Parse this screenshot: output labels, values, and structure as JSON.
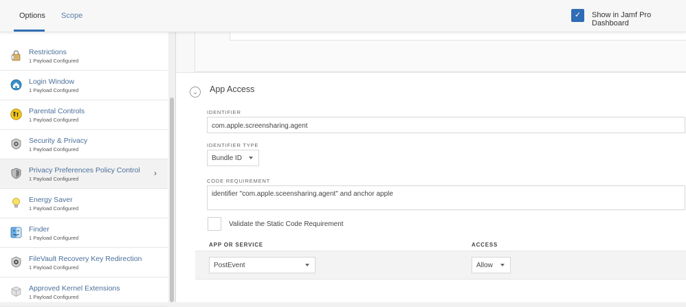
{
  "header": {
    "tabs": [
      {
        "label": "Options"
      },
      {
        "label": "Scope"
      }
    ],
    "dashboard_label": "Show in Jamf Pro Dashboard",
    "dashboard_checked": true,
    "accent_color": "#2f6db5"
  },
  "sidebar": {
    "items": [
      {
        "title": "Restrictions",
        "subtitle": "1 Payload Configured",
        "icon": "lock-icon"
      },
      {
        "title": "Login Window",
        "subtitle": "1 Payload Configured",
        "icon": "login-window-icon"
      },
      {
        "title": "Parental Controls",
        "subtitle": "1 Payload Configured",
        "icon": "parental-controls-icon"
      },
      {
        "title": "Security & Privacy",
        "subtitle": "1 Payload Configured",
        "icon": "security-icon"
      },
      {
        "title": "Privacy Preferences Policy Control",
        "subtitle": "1 Payload Configured",
        "icon": "shield-icon",
        "active": true
      },
      {
        "title": "Energy Saver",
        "subtitle": "1 Payload Configured",
        "icon": "lightbulb-icon"
      },
      {
        "title": "Finder",
        "subtitle": "1 Payload Configured",
        "icon": "finder-icon"
      },
      {
        "title": "FileVault Recovery Key Redirection",
        "subtitle": "1 Payload Configured",
        "icon": "filevault-icon"
      },
      {
        "title": "Approved Kernel Extensions",
        "subtitle": "1 Payload Configured",
        "icon": "kernel-extension-icon"
      }
    ]
  },
  "app_access": {
    "title": "App Access",
    "identifier_label": "IDENTIFIER",
    "identifier_value": "com.apple.screensharing.agent",
    "identifier_type_label": "IDENTIFIER TYPE",
    "identifier_type_value": "Bundle ID",
    "code_requirement_label": "CODE REQUIREMENT",
    "code_requirement_value": "identifier \"com.apple.sceensharing.agent\" and anchor apple",
    "validate_label": "Validate the Static Code Requirement",
    "validate_checked": false,
    "table": {
      "headers": [
        "APP OR SERVICE",
        "ACCESS"
      ],
      "rows": [
        {
          "service": "PostEvent",
          "access": "Allow"
        }
      ]
    }
  }
}
